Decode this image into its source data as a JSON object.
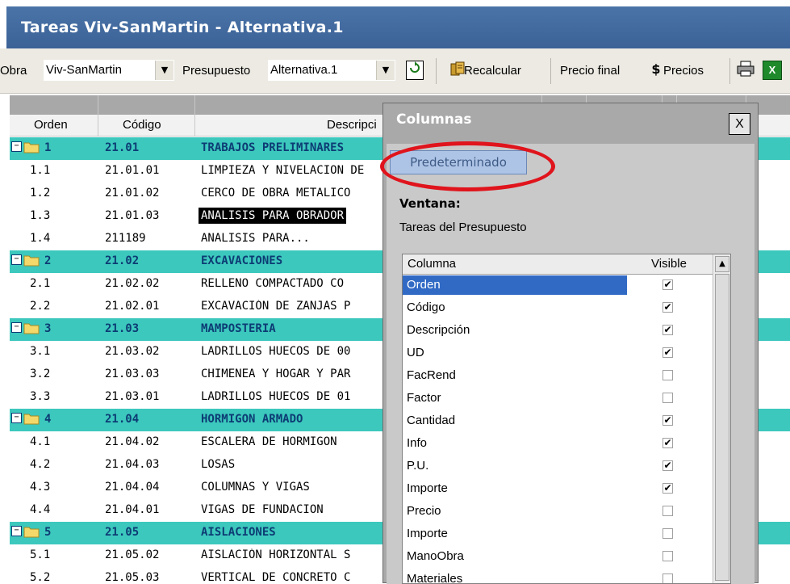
{
  "window": {
    "title": "Tareas Viv-SanMartin - Alternativa.1"
  },
  "toolbar": {
    "obra_label": "Obra",
    "obra_value": "Viv-SanMartin",
    "presupuesto_label": "Presupuesto",
    "presupuesto_value": "Alternativa.1",
    "recalcular_label": "Recalcular",
    "precio_final_label": "Precio final",
    "precios_label": "Precios"
  },
  "grid": {
    "headers": {
      "orden": "Orden",
      "codigo": "Código",
      "descripcion": "Descripci"
    },
    "rows": [
      {
        "type": "group",
        "orden": "1",
        "codigo": "21.01",
        "descripcion": "TRABAJOS PRELIMINARES"
      },
      {
        "type": "item",
        "orden": "1.1",
        "codigo": "21.01.01",
        "descripcion": "LIMPIEZA Y NIVELACION DE"
      },
      {
        "type": "item",
        "orden": "1.2",
        "codigo": "21.01.02",
        "descripcion": "CERCO DE OBRA METALICO"
      },
      {
        "type": "item",
        "orden": "1.3",
        "codigo": "21.01.03",
        "descripcion": "ANALISIS PARA OBRADOR",
        "selected": true
      },
      {
        "type": "item",
        "orden": "1.4",
        "codigo": "211189",
        "descripcion": "ANALISIS PARA..."
      },
      {
        "type": "group",
        "orden": "2",
        "codigo": "21.02",
        "descripcion": "EXCAVACIONES"
      },
      {
        "type": "item",
        "orden": "2.1",
        "codigo": "21.02.02",
        "descripcion": "RELLENO COMPACTADO CO"
      },
      {
        "type": "item",
        "orden": "2.2",
        "codigo": "21.02.01",
        "descripcion": "EXCAVACIÓN DE ZANJAS P"
      },
      {
        "type": "group",
        "orden": "3",
        "codigo": "21.03",
        "descripcion": "MAMPOSTERIA"
      },
      {
        "type": "item",
        "orden": "3.1",
        "codigo": "21.03.02",
        "descripcion": "LADRILLOS HUECOS DE 00"
      },
      {
        "type": "item",
        "orden": "3.2",
        "codigo": "21.03.03",
        "descripcion": "CHIMENEA Y HOGAR Y PAR"
      },
      {
        "type": "item",
        "orden": "3.3",
        "codigo": "21.03.01",
        "descripcion": "LADRILLOS HUECOS DE 01"
      },
      {
        "type": "group",
        "orden": "4",
        "codigo": "21.04",
        "descripcion": "HORMIGON ARMADO"
      },
      {
        "type": "item",
        "orden": "4.1",
        "codigo": "21.04.02",
        "descripcion": "ESCALERA DE HORMIGON"
      },
      {
        "type": "item",
        "orden": "4.2",
        "codigo": "21.04.03",
        "descripcion": "LOSAS"
      },
      {
        "type": "item",
        "orden": "4.3",
        "codigo": "21.04.04",
        "descripcion": "COLUMNAS Y VIGAS"
      },
      {
        "type": "item",
        "orden": "4.4",
        "codigo": "21.04.01",
        "descripcion": "VIGAS DE FUNDACION"
      },
      {
        "type": "group",
        "orden": "5",
        "codigo": "21.05",
        "descripcion": "AISLACIONES"
      },
      {
        "type": "item",
        "orden": "5.1",
        "codigo": "21.05.02",
        "descripcion": "AISLACIÓN HORIZONTAL S"
      },
      {
        "type": "item",
        "orden": "5.2",
        "codigo": "21.05.03",
        "descripcion": "VERTICAL DE CONCRETO C"
      }
    ]
  },
  "dialog": {
    "title": "Columnas",
    "close_label": "X",
    "predeterminado_label": "Predeterminado",
    "ventana_label": "Ventana:",
    "ventana_value": "Tareas del Presupuesto",
    "col_header_columna": "Columna",
    "col_header_visible": "Visible",
    "columns": [
      {
        "name": "Orden",
        "visible": true,
        "selected": true
      },
      {
        "name": "Código",
        "visible": true
      },
      {
        "name": "Descripción",
        "visible": true
      },
      {
        "name": "UD",
        "visible": true
      },
      {
        "name": "FacRend",
        "visible": false
      },
      {
        "name": "Factor",
        "visible": false
      },
      {
        "name": "Cantidad",
        "visible": true
      },
      {
        "name": "Info",
        "visible": true
      },
      {
        "name": "P.U.",
        "visible": true
      },
      {
        "name": "Importe",
        "visible": true
      },
      {
        "name": "Precio",
        "visible": false
      },
      {
        "name": "Importe",
        "visible": false
      },
      {
        "name": "ManoObra",
        "visible": false
      },
      {
        "name": "Materiales",
        "visible": false
      }
    ]
  },
  "colors": {
    "title_bar": "#3c6297",
    "group_row": "#3cc8bd",
    "group_text": "#0d3c74",
    "highlight_ellipse": "#e0141c"
  }
}
